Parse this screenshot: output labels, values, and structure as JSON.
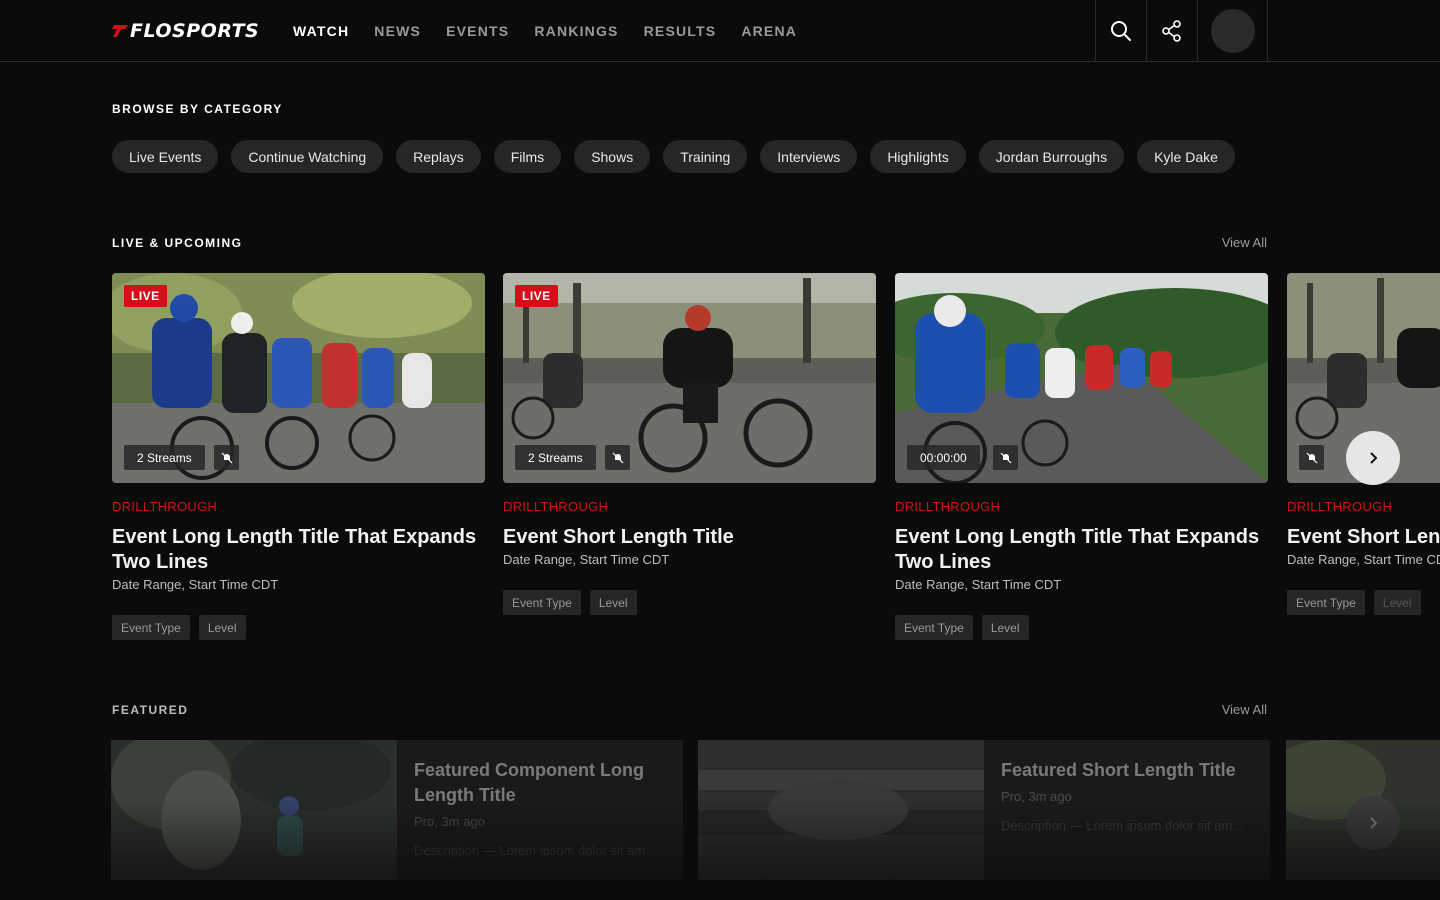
{
  "header": {
    "logo_text": "FLOSPORTS",
    "nav": [
      {
        "label": "WATCH",
        "active": true
      },
      {
        "label": "NEWS"
      },
      {
        "label": "EVENTS"
      },
      {
        "label": "RANKINGS"
      },
      {
        "label": "RESULTS"
      },
      {
        "label": "ARENA"
      }
    ],
    "icons": [
      "search-icon",
      "share-icon",
      "avatar"
    ]
  },
  "browse": {
    "title": "BROWSE BY CATEGORY",
    "chips": [
      "Live Events",
      "Continue Watching",
      "Replays",
      "Films",
      "Shows",
      "Training",
      "Interviews",
      "Highlights",
      "Jordan Burroughs",
      "Kyle Dake"
    ]
  },
  "live": {
    "title": "LIVE & UPCOMING",
    "view_all": "View All",
    "cards": [
      {
        "badge": "LIVE",
        "streams": "2 Streams",
        "eyebrow": "DRILLTHROUGH",
        "title": "Event Long Length Title That Expands Two Lines",
        "subtitle": "Date Range, Start Time CDT",
        "tags": [
          "Event Type",
          "Level"
        ]
      },
      {
        "badge": "LIVE",
        "streams": "2 Streams",
        "eyebrow": "DRILLTHROUGH",
        "title": "Event Short Length Title",
        "subtitle": "Date Range, Start Time CDT",
        "tags": [
          "Event Type",
          "Level"
        ]
      },
      {
        "badge": "",
        "streams": "00:00:00",
        "eyebrow": "DRILLTHROUGH",
        "title": "Event Long Length Title That Expands Two Lines",
        "subtitle": "Date Range, Start Time CDT",
        "tags": [
          "Event Type",
          "Level"
        ]
      },
      {
        "badge": "",
        "streams": "",
        "eyebrow": "DRILLTHROUGH",
        "title": "Event Short Length Title",
        "subtitle": "Date Range, Start Time CDT",
        "tags": [
          "Event Type",
          "Level"
        ]
      }
    ]
  },
  "featured": {
    "title": "FEATURED",
    "view_all": "View All",
    "cards": [
      {
        "title": "Featured Component Long Length Title",
        "meta": "Pro, 3m ago",
        "description": "Description — Lorem ipsum dolor sit am..."
      },
      {
        "title": "Featured Short Length Title",
        "meta": "Pro, 3m ago",
        "description": "Description — Lorem ipsum dolor sit am..."
      }
    ]
  },
  "colors": {
    "accent": "#d3101a",
    "background": "#0b0b0b",
    "chip": "#262626"
  }
}
